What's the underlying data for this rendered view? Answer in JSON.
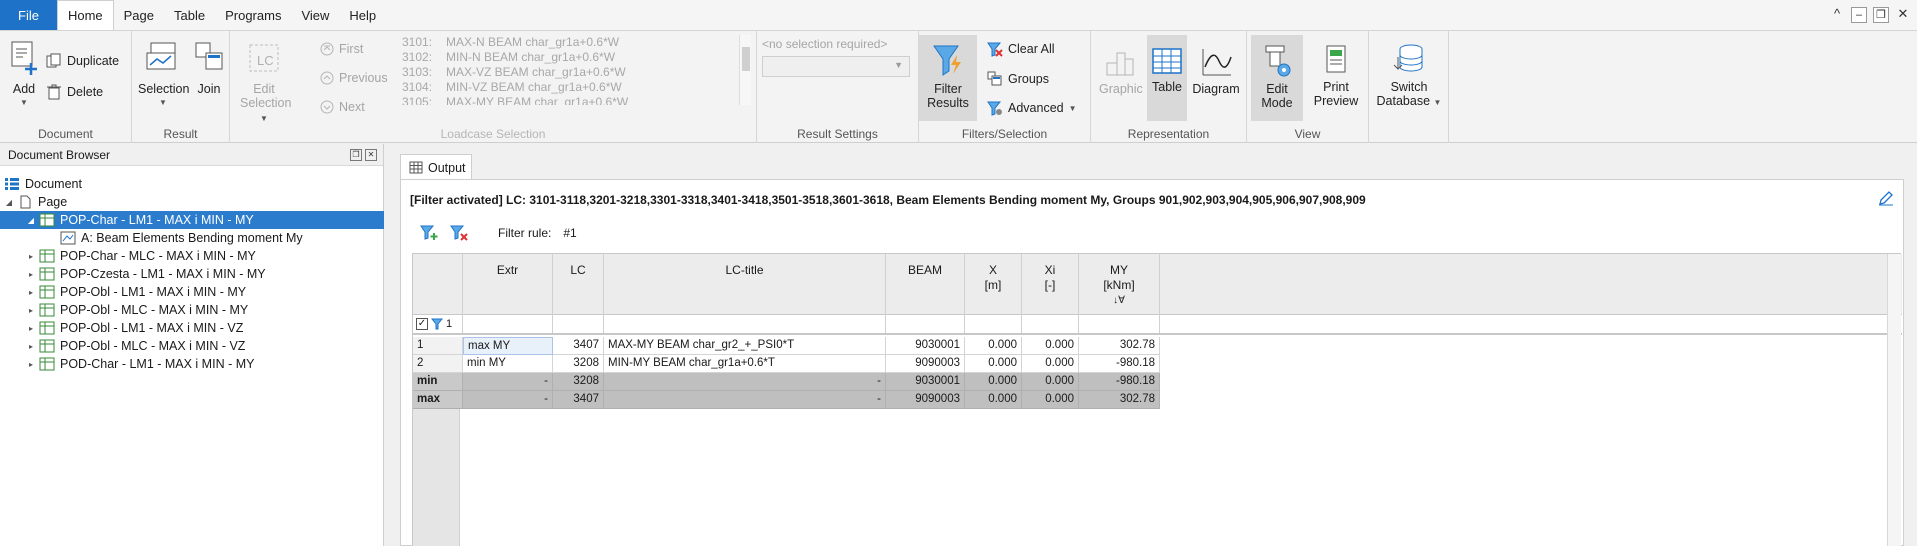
{
  "menu": {
    "file": "File",
    "items": [
      "Home",
      "Page",
      "Table",
      "Programs",
      "View",
      "Help"
    ],
    "window_controls": [
      "^",
      "–",
      "❐",
      "✕"
    ]
  },
  "ribbon": {
    "document": {
      "label": "Document",
      "add": "Add",
      "duplicate": "Duplicate",
      "delete": "Delete"
    },
    "result": {
      "label": "Result",
      "selection": "Selection",
      "join": "Join"
    },
    "loadcase_selection": {
      "label": "Loadcase Selection",
      "edit_selection_line1": "Edit",
      "edit_selection_line2": "Selection",
      "lc_icon_text": "LC",
      "first": "First",
      "previous": "Previous",
      "next": "Next",
      "list": [
        {
          "num": "3101:",
          "text": "MAX-N BEAM char_gr1a+0.6*W"
        },
        {
          "num": "3102:",
          "text": "MIN-N BEAM char_gr1a+0.6*W"
        },
        {
          "num": "3103:",
          "text": "MAX-VZ BEAM char_gr1a+0.6*W"
        },
        {
          "num": "3104:",
          "text": "MIN-VZ BEAM char_gr1a+0.6*W"
        },
        {
          "num": "3105:",
          "text": "MAX-MY BEAM char_gr1a+0.6*W"
        }
      ]
    },
    "result_settings": {
      "label": "Result Settings",
      "no_selection": "<no selection required>"
    },
    "filters": {
      "label": "Filters/Selection",
      "filter_results_line1": "Filter",
      "filter_results_line2": "Results",
      "clear_all": "Clear All",
      "groups": "Groups",
      "advanced": "Advanced"
    },
    "representation": {
      "label": "Representation",
      "graphic": "Graphic",
      "table": "Table",
      "diagram": "Diagram"
    },
    "view": {
      "label": "View",
      "edit_mode_line1": "Edit",
      "edit_mode_line2": "Mode",
      "print_preview_line1": "Print",
      "print_preview_line2": "Preview"
    },
    "database": {
      "switch_line1": "Switch",
      "switch_line2": "Database"
    }
  },
  "document_browser": {
    "title": "Document Browser",
    "items": [
      {
        "label": "Document"
      },
      {
        "label": "Page"
      },
      {
        "label": "POP-Char - LM1 - MAX i MIN - MY"
      },
      {
        "label": "A: Beam Elements Bending moment My"
      },
      {
        "label": "POP-Char - MLC - MAX i MIN - MY"
      },
      {
        "label": "POP-Czesta - LM1 - MAX i MIN - MY"
      },
      {
        "label": "POP-Obl - LM1 - MAX i MIN - MY"
      },
      {
        "label": "POP-Obl - MLC - MAX i MIN - MY"
      },
      {
        "label": "POP-Obl - LM1 -  MAX i MIN - VZ"
      },
      {
        "label": "POP-Obl - MLC -  MAX i MIN - VZ"
      },
      {
        "label": "POD-Char - LM1 - MAX i MIN - MY"
      }
    ]
  },
  "output": {
    "tab": "Output",
    "filter_info": "[Filter activated] LC: 3101-3118,3201-3218,3301-3318,3401-3418,3501-3518,3601-3618, Beam Elements Bending moment My, Groups 901,902,903,904,905,906,907,908,909",
    "filter_rule_label": "Filter rule:",
    "filter_rule_value": "#1",
    "filter_row_value": "1",
    "columns": {
      "extr": "Extr",
      "lc": "LC",
      "lc_title": "LC-title",
      "beam": "BEAM",
      "x": "X",
      "x_unit": "[m]",
      "xi": "Xi",
      "xi_unit": "[-]",
      "my": "MY",
      "my_unit": "[kNm]"
    },
    "rows": [
      {
        "idx": "1",
        "extr": "max MY",
        "lc": "3407",
        "title": "MAX-MY BEAM char_gr2_+_PSI0*T",
        "beam": "9030001",
        "x": "0.000",
        "xi": "0.000",
        "my": "302.78"
      },
      {
        "idx": "2",
        "extr": "min MY",
        "lc": "3208",
        "title": "MIN-MY BEAM char_gr1a+0.6*T",
        "beam": "9090003",
        "x": "0.000",
        "xi": "0.000",
        "my": "-980.18"
      }
    ],
    "summary": [
      {
        "idx": "min",
        "extr": "-",
        "lc": "3208",
        "title": "-",
        "beam": "9030001",
        "x": "0.000",
        "xi": "0.000",
        "my": "-980.18"
      },
      {
        "idx": "max",
        "extr": "-",
        "lc": "3407",
        "title": "-",
        "beam": "9090003",
        "x": "0.000",
        "xi": "0.000",
        "my": "302.78"
      }
    ]
  }
}
